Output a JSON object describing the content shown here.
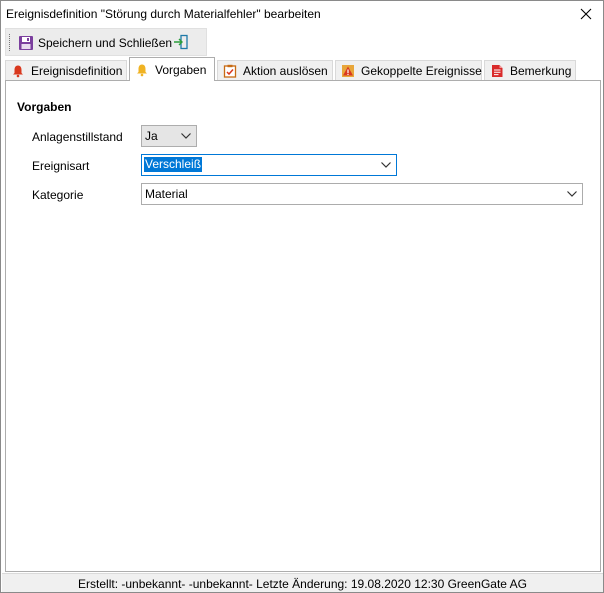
{
  "window": {
    "title": "Ereignisdefinition \"Störung durch Materialfehler\" bearbeiten"
  },
  "toolbar": {
    "save_label": "Speichern und Schließen"
  },
  "tabs": [
    {
      "label": "Ereignisdefinition",
      "icon": "red-bell-icon"
    },
    {
      "label": "Vorgaben",
      "icon": "yellow-bell-icon",
      "active": true
    },
    {
      "label": "Aktion auslösen",
      "icon": "checklist-icon"
    },
    {
      "label": "Gekoppelte Ereignisse",
      "icon": "linked-events-icon"
    },
    {
      "label": "Bemerkung",
      "icon": "note-icon"
    }
  ],
  "form": {
    "group_title": "Vorgaben",
    "fields": [
      {
        "label": "Anlagenstillstand",
        "value": "Ja"
      },
      {
        "label": "Ereignisart",
        "value": "Verschleiß"
      },
      {
        "label": "Kategorie",
        "value": "Material"
      }
    ]
  },
  "status": {
    "text": "Erstellt: -unbekannt- -unbekannt-  Letzte Änderung: 19.08.2020 12:30 GreenGate AG"
  },
  "colors": {
    "accent": "#0078d7",
    "save_icon": "#7b3f9e",
    "tab_note": "#d92b2b"
  }
}
